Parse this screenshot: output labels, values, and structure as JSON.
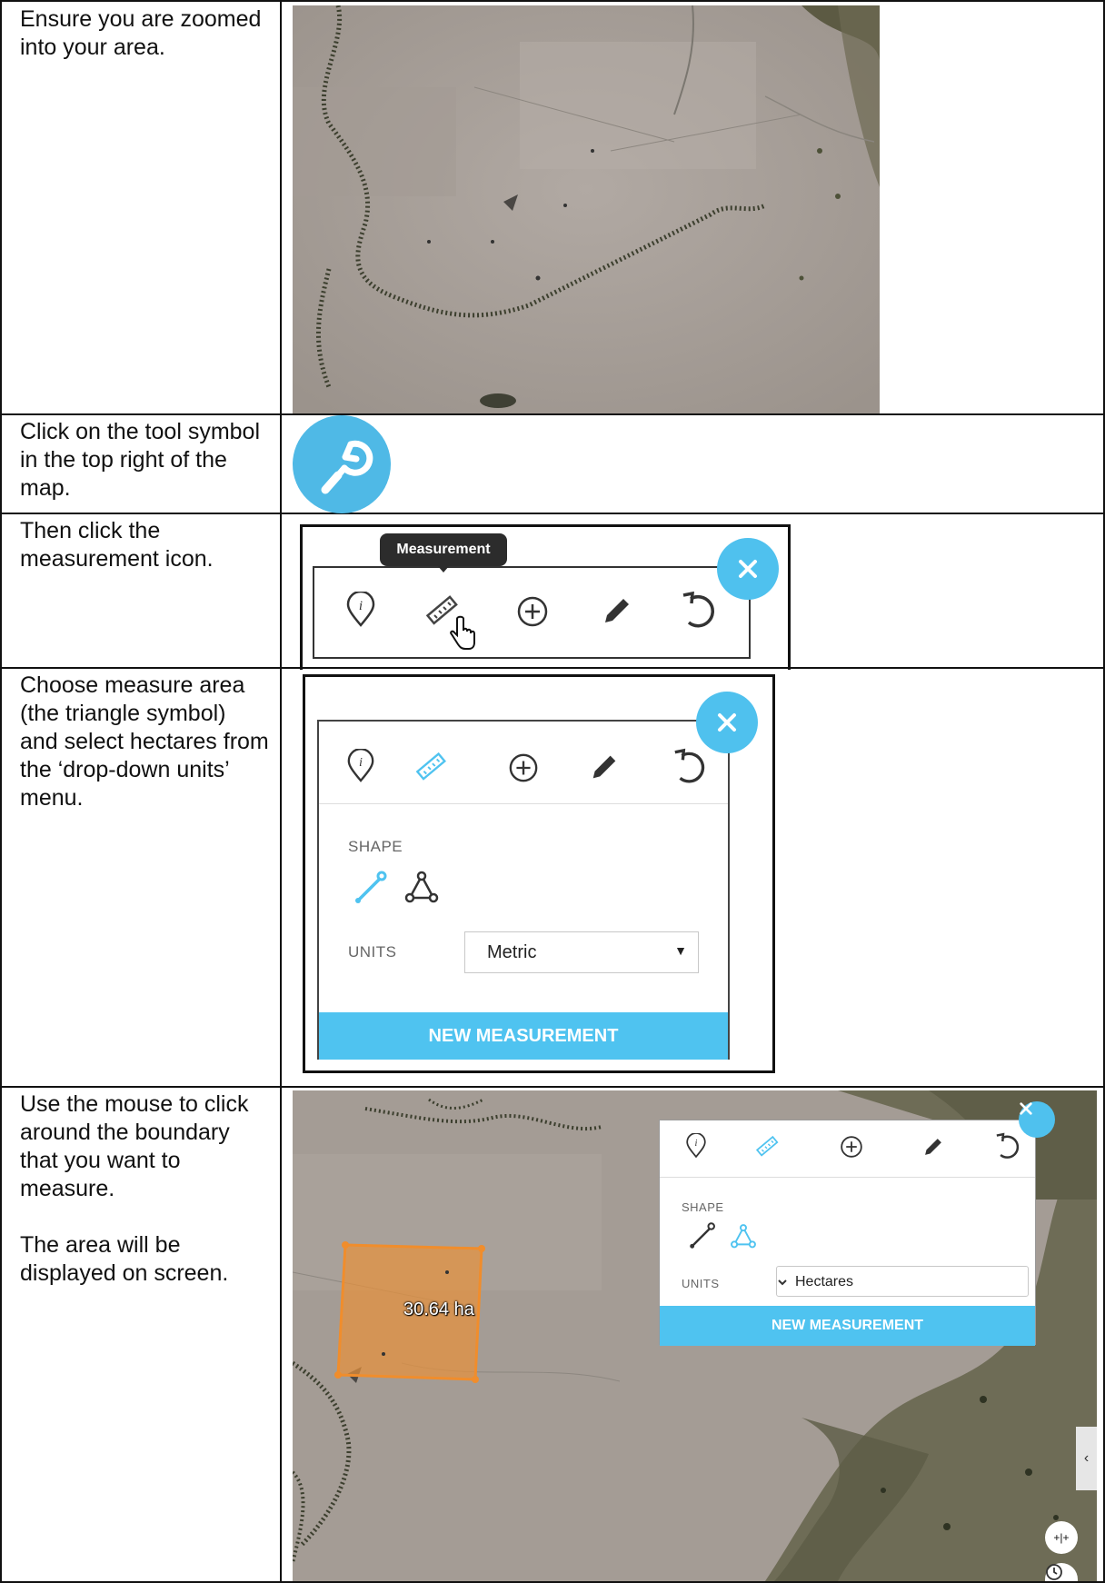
{
  "steps": {
    "zoom": "Ensure you are zoomed into your area.",
    "tool": "Click on the tool symbol in the top right of the map.",
    "measure_icon": "Then click the measurement icon.",
    "choose_area": "Choose measure area (the triangle symbol) and select hectares from the ‘drop-down units’ menu.",
    "click_boundary": "Use the mouse to click around the boundary that you want to measure.",
    "displayed": "The area will be displayed on screen."
  },
  "toolbar": {
    "tooltip": "Measurement",
    "icons": [
      "info-icon",
      "ruler-icon",
      "add-icon",
      "pencil-icon",
      "undo-icon"
    ]
  },
  "panel_metric": {
    "shape_label": "SHAPE",
    "units_label": "UNITS",
    "units_value": "Metric",
    "button": "NEW MEASUREMENT"
  },
  "panel_hectares": {
    "shape_label": "SHAPE",
    "units_label": "UNITS",
    "units_value": "Hectares",
    "button": "NEW MEASUREMENT"
  },
  "measurement": {
    "area_label": "30.64 ha"
  },
  "colors": {
    "accent": "#4fc3f0",
    "area_fill": "#e8923b"
  }
}
